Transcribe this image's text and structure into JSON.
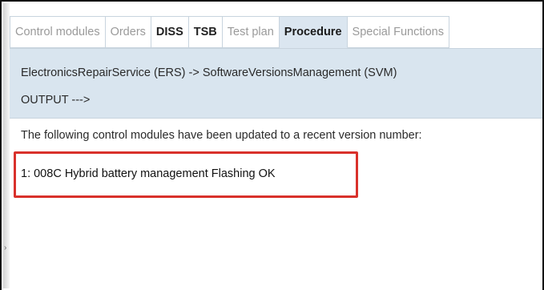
{
  "tabs": [
    {
      "label": "Control modules",
      "style": "normal"
    },
    {
      "label": "Orders",
      "style": "normal"
    },
    {
      "label": "DISS",
      "style": "bold"
    },
    {
      "label": "TSB",
      "style": "bold"
    },
    {
      "label": "Test plan",
      "style": "normal"
    },
    {
      "label": "Procedure",
      "style": "active"
    },
    {
      "label": "Special Functions",
      "style": "normal"
    }
  ],
  "header": {
    "path": "ElectronicsRepairService (ERS) -> SoftwareVersionsManagement (SVM)",
    "output_label": "OUTPUT --->"
  },
  "content": {
    "message": "The following control modules have been updated to a recent version number:",
    "result": "1: 008C Hybrid battery management Flashing OK"
  },
  "colors": {
    "header_bg": "#d9e5ef",
    "highlight_border": "#d9312b",
    "inactive_tab_text": "#9a9a9a"
  }
}
